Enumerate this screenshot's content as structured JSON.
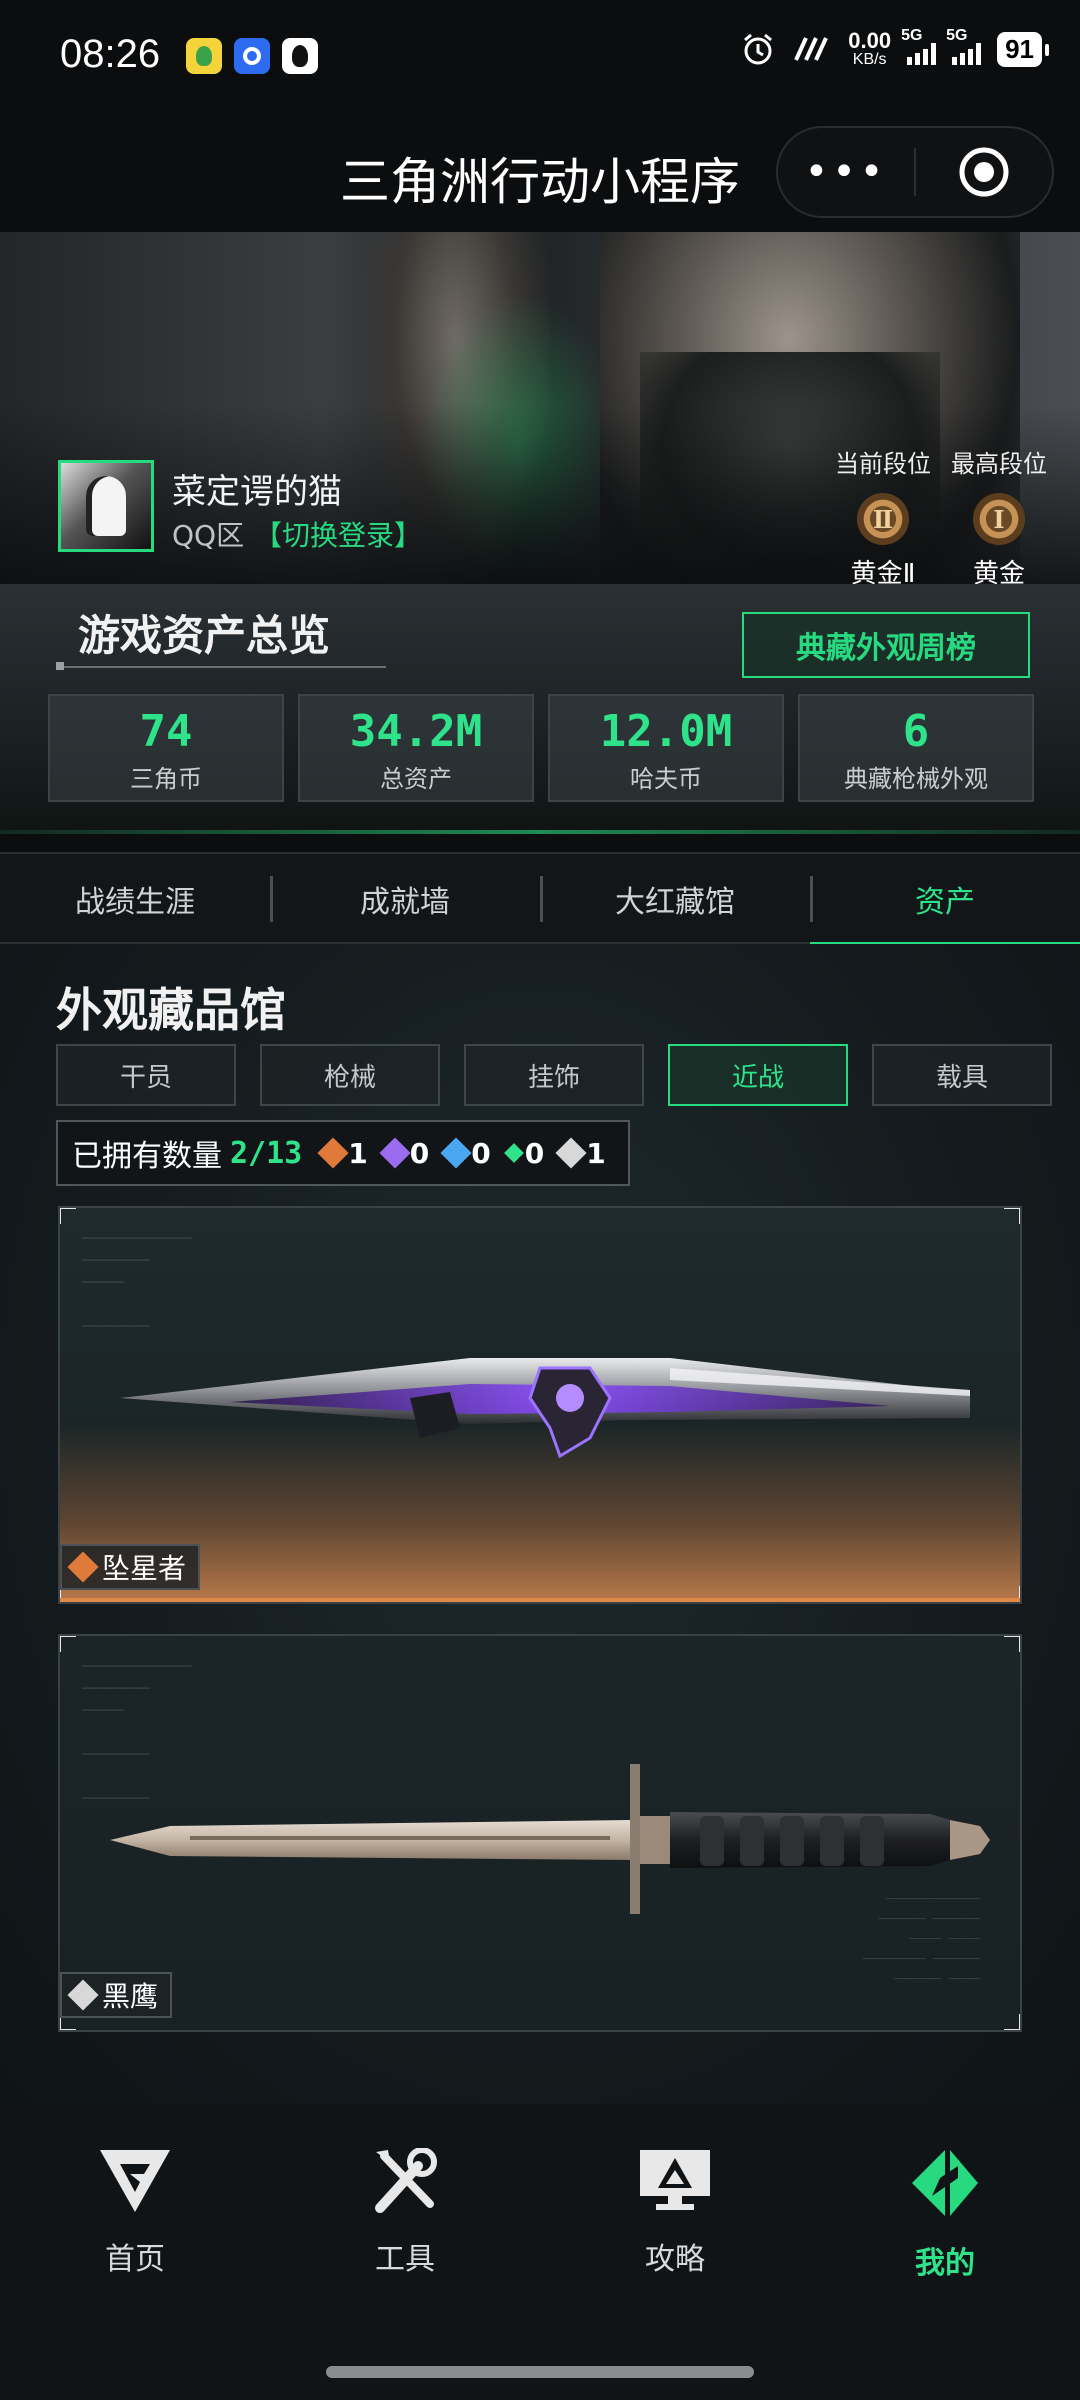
{
  "status_bar": {
    "time": "08:26",
    "net_speed": "0.00",
    "net_unit": "KB/s",
    "sim1": "5G",
    "sim2": "5G",
    "battery": "91"
  },
  "app": {
    "title": "三角洲行动小程序",
    "more_label": "•••"
  },
  "profile": {
    "username": "菜定谔的猫",
    "zone": "QQ区",
    "switch_login": "【切换登录】",
    "current_rank_label": "当前段位",
    "current_rank": "黄金Ⅱ",
    "current_rank_numeral": "Ⅱ",
    "highest_rank_label": "最高段位",
    "highest_rank": "黄金",
    "highest_rank_numeral": "Ⅰ"
  },
  "overview": {
    "title": "游戏资产总览",
    "weekly_button": "典藏外观周榜",
    "stats": [
      {
        "value": "74",
        "label": "三角币"
      },
      {
        "value": "34.2M",
        "label": "总资产"
      },
      {
        "value": "12.0M",
        "label": "哈夫币"
      },
      {
        "value": "6",
        "label": "典藏枪械外观"
      }
    ]
  },
  "tabs": [
    {
      "label": "战绩生涯",
      "active": false
    },
    {
      "label": "成就墙",
      "active": false
    },
    {
      "label": "大红藏馆",
      "active": false
    },
    {
      "label": "资产",
      "active": true
    }
  ],
  "collection": {
    "title": "外观藏品馆",
    "categories": [
      {
        "label": "干员",
        "active": false
      },
      {
        "label": "枪械",
        "active": false
      },
      {
        "label": "挂饰",
        "active": false
      },
      {
        "label": "近战",
        "active": true
      },
      {
        "label": "载具",
        "active": false
      }
    ],
    "owned_label": "已拥有数量",
    "owned_count": "2/13",
    "rarities": [
      {
        "count": "1",
        "color": "#e07a3a"
      },
      {
        "count": "0",
        "color": "#9b6cf0"
      },
      {
        "count": "0",
        "color": "#4aa6f0"
      },
      {
        "count": "0",
        "color": "#2fe38b"
      },
      {
        "count": "1",
        "color": "#d8d8d8"
      }
    ],
    "items": [
      {
        "name": "坠星者",
        "rarity_color": "#e07a3a"
      },
      {
        "name": "黑鹰",
        "rarity_color": "#d8d8d8"
      }
    ]
  },
  "bottom_nav": [
    {
      "label": "首页",
      "icon": "home-logo-icon",
      "active": false
    },
    {
      "label": "工具",
      "icon": "tools-icon",
      "active": false
    },
    {
      "label": "攻略",
      "icon": "guide-monitor-icon",
      "active": false
    },
    {
      "label": "我的",
      "icon": "profile-logo-icon",
      "active": true
    }
  ],
  "colors": {
    "accent": "#27d97f",
    "background": "#0b0d0f"
  }
}
